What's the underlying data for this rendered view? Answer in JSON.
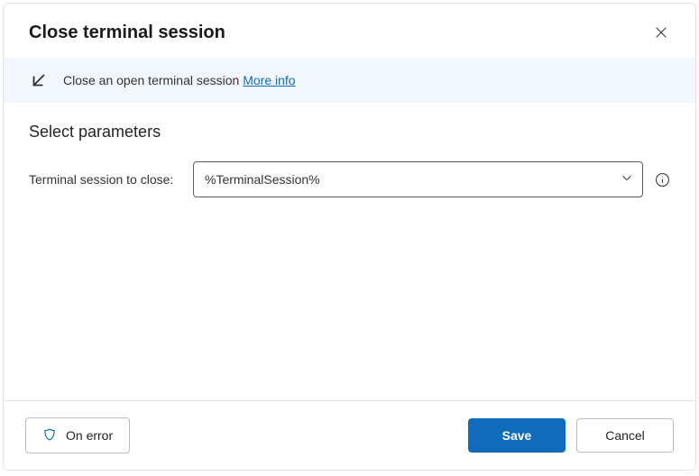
{
  "header": {
    "title": "Close terminal session"
  },
  "info": {
    "description": "Close an open terminal session",
    "more_info_label": "More info"
  },
  "body": {
    "section_title": "Select parameters",
    "param_label": "Terminal session to close:",
    "param_value": "%TerminalSession%"
  },
  "footer": {
    "on_error_label": "On error",
    "save_label": "Save",
    "cancel_label": "Cancel"
  }
}
